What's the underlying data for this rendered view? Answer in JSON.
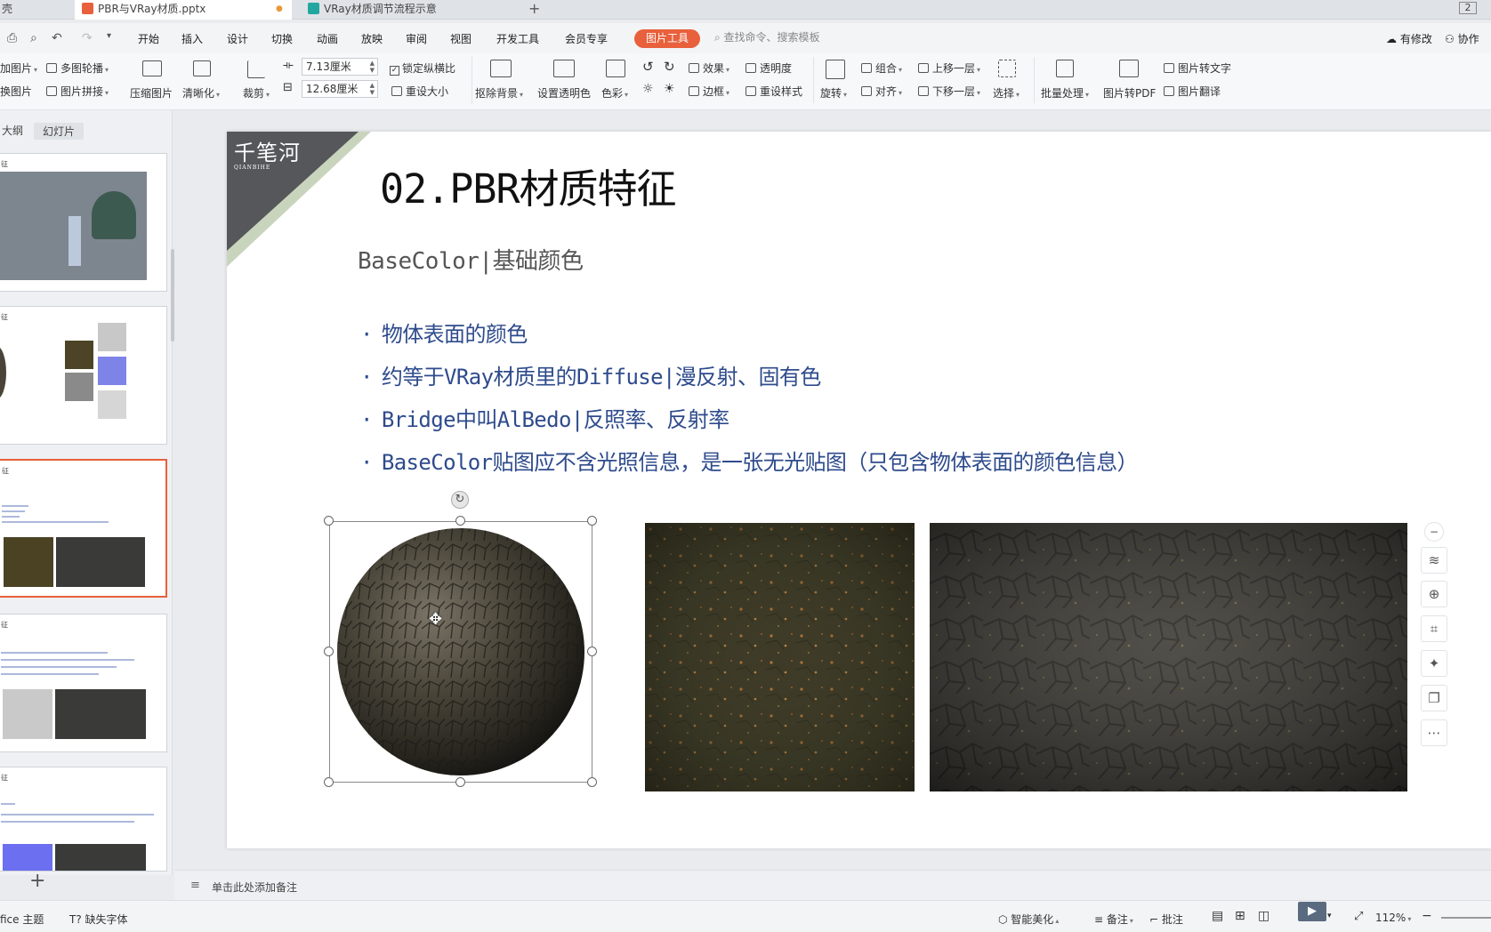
{
  "tabs": [
    {
      "label": "壳",
      "active": false
    },
    {
      "label": "PBR与VRay材质.pptx",
      "active": true,
      "modified_dot": "●"
    },
    {
      "label": "VRay材质调节流程示意",
      "active": false
    }
  ],
  "tabbar": {
    "new_tab": "+",
    "window_count": "2"
  },
  "menu": {
    "items": [
      "开始",
      "插入",
      "设计",
      "切换",
      "动画",
      "放映",
      "审阅",
      "视图",
      "开发工具",
      "会员专享"
    ],
    "picture_tools": "图片工具",
    "search_placeholder": "查找命令、搜索模板",
    "has_changes": "有修改",
    "collaborate": "协作"
  },
  "ribbon": {
    "insert_picture": "加图片",
    "multi_outline": "多图轮播",
    "replace_picture": "换图片",
    "picture_stitch": "图片拼接",
    "compress": "压缩图片",
    "sharpen": "清晰化",
    "crop": "裁剪",
    "width_value": "7.13厘米",
    "height_value": "12.68厘米",
    "lock_ratio": "锁定纵横比",
    "reset_size": "重设大小",
    "remove_bg": "抠除背景",
    "set_transparent": "设置透明色",
    "color": "色彩",
    "effects": "效果",
    "transparency": "透明度",
    "border": "边框",
    "reset_style": "重设样式",
    "rotate": "旋转",
    "group": "组合",
    "align": "对齐",
    "bring_forward": "上移一层",
    "send_backward": "下移一层",
    "select": "选择",
    "batch": "批量处理",
    "to_pdf": "图片转PDF",
    "to_text": "图片转文字",
    "translate": "图片翻译"
  },
  "left_panel": {
    "tab_outline": "大纲",
    "tab_slides": "幻灯片",
    "thumb_title": "征",
    "add_slide": "+"
  },
  "slide": {
    "logo_text": "千笔河",
    "logo_sub": "QIANBIHE",
    "title": "02.PBR材质特征",
    "subtitle": "BaseColor|基础颜色",
    "bullet_marker": "·",
    "bullets": [
      "物体表面的颜色",
      "约等于VRay材质里的Diffuse|漫反射、固有色",
      "Bridge中叫AlBedo|反照率、反射率",
      "BaseColor贴图应不含光照信息，是一张无光贴图（只包含物体表面的颜色信息）"
    ],
    "colors": {
      "title": "#111111",
      "bullet": "#2e4b8c",
      "corner_dark": "#55575a",
      "corner_light": "#c9d4bd"
    }
  },
  "float_tools": [
    "minus-circle-icon",
    "layers-icon",
    "zoom-icon",
    "crop-icon",
    "bulb-icon",
    "copy-icon",
    "more-icon"
  ],
  "notes": {
    "placeholder": "单击此处添加备注"
  },
  "statusbar": {
    "theme": "fice 主题",
    "missing_font": "缺失字体",
    "beautify": "智能美化",
    "notes": "备注",
    "comments": "批注",
    "zoom": "112%"
  }
}
